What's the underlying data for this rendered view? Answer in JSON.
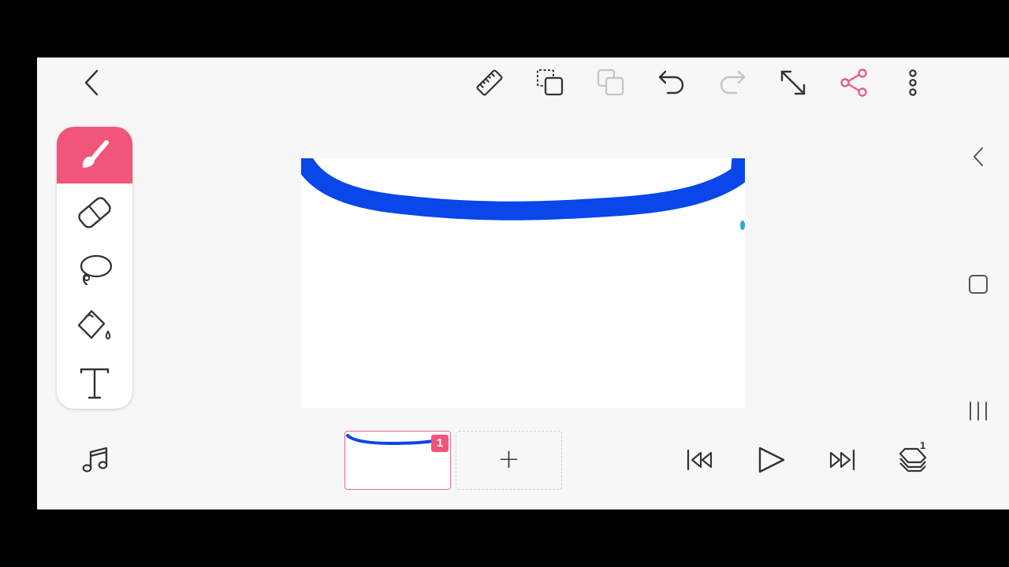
{
  "app": {
    "accent_color": "#f2557a",
    "stroke_color": "#0a46e8"
  },
  "toolbar": {
    "back": {
      "icon": "back-chevron-icon"
    },
    "actions": [
      {
        "name": "ruler",
        "icon": "ruler-icon",
        "enabled": true
      },
      {
        "name": "duplicate-frame",
        "icon": "copy-frame-icon",
        "enabled": true
      },
      {
        "name": "paste",
        "icon": "paste-icon",
        "enabled": false
      },
      {
        "name": "undo",
        "icon": "undo-icon",
        "enabled": true
      },
      {
        "name": "redo",
        "icon": "redo-icon",
        "enabled": false
      },
      {
        "name": "fullscreen",
        "icon": "expand-diagonal-icon",
        "enabled": true
      },
      {
        "name": "share",
        "icon": "share-icon",
        "enabled": true
      },
      {
        "name": "more",
        "icon": "more-vertical-icon",
        "enabled": true
      }
    ]
  },
  "tools": [
    {
      "name": "brush",
      "icon": "brush-icon",
      "active": true
    },
    {
      "name": "eraser",
      "icon": "eraser-icon",
      "active": false
    },
    {
      "name": "lasso",
      "icon": "lasso-icon",
      "active": false
    },
    {
      "name": "fill",
      "icon": "paint-bucket-icon",
      "active": false
    },
    {
      "name": "text",
      "icon": "text-icon",
      "active": false
    }
  ],
  "bottom": {
    "music_icon": "music-note-icon",
    "frames": [
      {
        "number": "1",
        "selected": true
      }
    ],
    "add_frame_label": "+",
    "playback": [
      {
        "name": "first-frame",
        "icon": "skip-to-start-icon"
      },
      {
        "name": "play",
        "icon": "play-icon"
      },
      {
        "name": "last-frame",
        "icon": "skip-to-end-icon"
      },
      {
        "name": "layers",
        "icon": "layers-icon",
        "count": "1"
      }
    ]
  },
  "system_nav": {
    "icons": [
      "back-chevron-icon",
      "home-square-icon",
      "recents-bars-icon"
    ]
  }
}
